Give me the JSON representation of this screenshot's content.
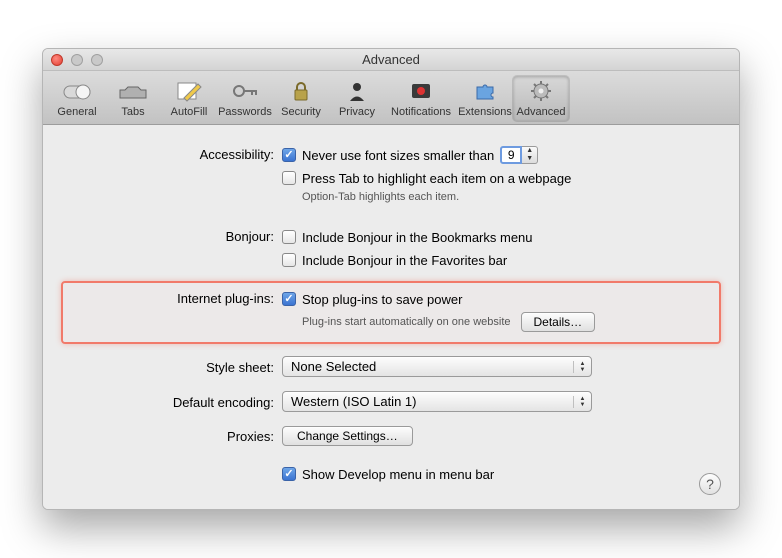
{
  "window": {
    "title": "Advanced"
  },
  "toolbar": {
    "items": [
      {
        "label": "General"
      },
      {
        "label": "Tabs"
      },
      {
        "label": "AutoFill"
      },
      {
        "label": "Passwords"
      },
      {
        "label": "Security"
      },
      {
        "label": "Privacy"
      },
      {
        "label": "Notifications"
      },
      {
        "label": "Extensions"
      },
      {
        "label": "Advanced"
      }
    ],
    "selected": "Advanced"
  },
  "accessibility": {
    "label": "Accessibility:",
    "font_size_checkbox": "Never use font sizes smaller than",
    "font_size_value": "9",
    "press_tab_checkbox": "Press Tab to highlight each item on a webpage",
    "press_tab_hint": "Option-Tab highlights each item."
  },
  "bonjour": {
    "label": "Bonjour:",
    "bookmarks_checkbox": "Include Bonjour in the Bookmarks menu",
    "favorites_checkbox": "Include Bonjour in the Favorites bar"
  },
  "plugins": {
    "label": "Internet plug-ins:",
    "stop_checkbox": "Stop plug-ins to save power",
    "hint": "Plug-ins start automatically on one website",
    "details_button": "Details…"
  },
  "stylesheet": {
    "label": "Style sheet:",
    "value": "None Selected"
  },
  "encoding": {
    "label": "Default encoding:",
    "value": "Western (ISO Latin 1)"
  },
  "proxies": {
    "label": "Proxies:",
    "button": "Change Settings…"
  },
  "develop": {
    "checkbox": "Show Develop menu in menu bar"
  },
  "help": {
    "glyph": "?"
  }
}
